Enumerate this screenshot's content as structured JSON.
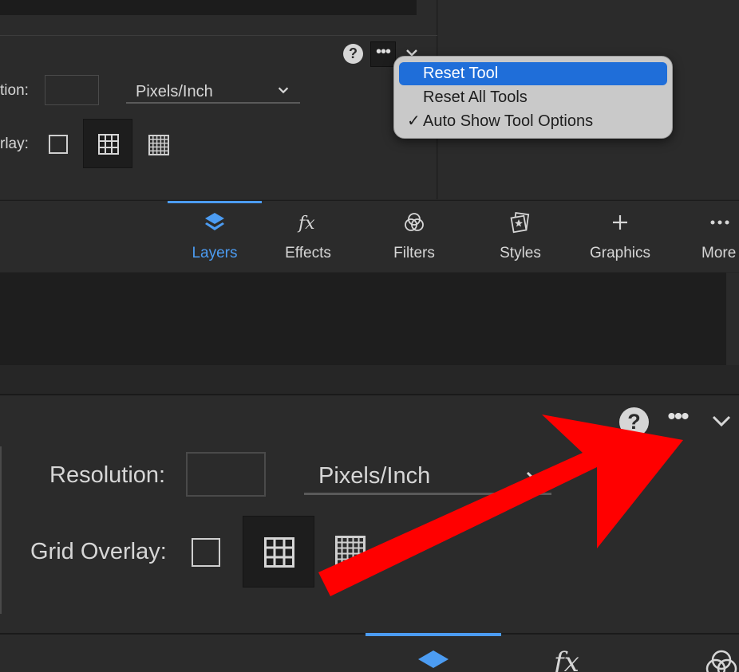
{
  "top_panel": {
    "help_label": "?",
    "more_label": "•••",
    "resolution_label": "tion:",
    "unit_value": "Pixels/Inch",
    "grid_overlay_label": "rlay:"
  },
  "menu": {
    "items": [
      {
        "label": "Reset Tool",
        "checked": false,
        "highlighted": true
      },
      {
        "label": "Reset All Tools",
        "checked": false,
        "highlighted": false
      },
      {
        "label": "Auto Show Tool Options",
        "checked": true,
        "highlighted": false
      }
    ],
    "check_glyph": "✓"
  },
  "tabs": [
    {
      "label": "Layers",
      "icon": "layers-icon",
      "active": true
    },
    {
      "label": "Effects",
      "icon": "fx-icon",
      "active": false
    },
    {
      "label": "Filters",
      "icon": "filters-icon",
      "active": false
    },
    {
      "label": "Styles",
      "icon": "styles-icon",
      "active": false
    },
    {
      "label": "Graphics",
      "icon": "plus-icon",
      "active": false
    },
    {
      "label": "More",
      "icon": "more-icon",
      "active": false
    }
  ],
  "bottom_panel": {
    "help_label": "?",
    "more_label": "•••",
    "resolution_label": "Resolution:",
    "unit_value": "Pixels/Inch",
    "grid_overlay_label": "Grid Overlay:"
  },
  "colors": {
    "accent": "#4c9cf2",
    "menu_highlight": "#1f6ed9",
    "arrow": "#ff0000",
    "panel_bg": "#2b2b2b"
  }
}
